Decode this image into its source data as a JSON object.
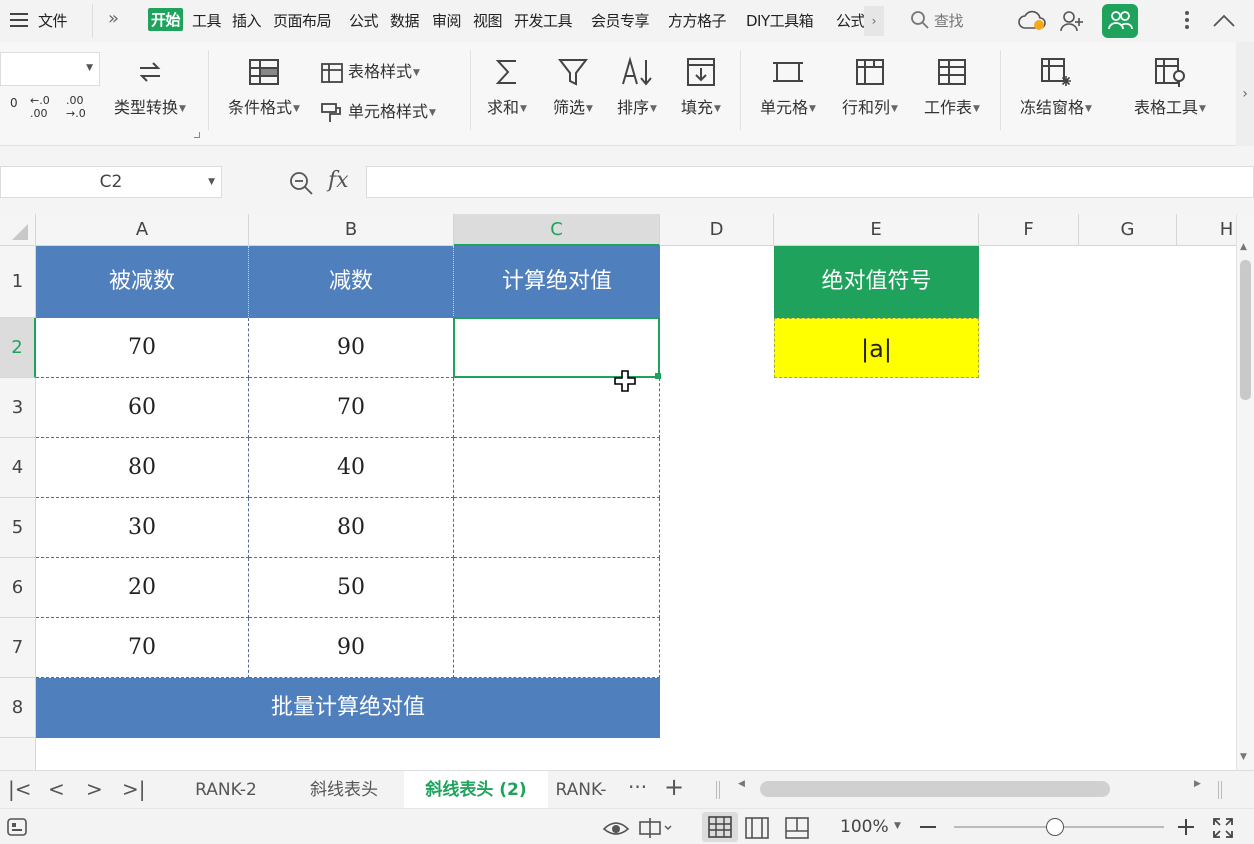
{
  "menubar": {
    "file_label": "文件",
    "more_label": "»",
    "tabs": [
      "开始",
      "工具",
      "插入",
      "页面布局",
      "公式",
      "数据",
      "审阅",
      "视图",
      "开发工具",
      "会员专享",
      "方方格子",
      "DIY工具箱",
      "公式"
    ],
    "search_label": "查找"
  },
  "ribbon": {
    "number_format_buttons": [
      "0",
      "←.0 .00",
      ".00 →.0"
    ],
    "type_convert_label": "类型转换",
    "conditional_format_label": "条件格式",
    "table_style_label": "表格样式",
    "cell_style_label": "单元格样式",
    "sum_label": "求和",
    "filter_label": "筛选",
    "sort_label": "排序",
    "fill_label": "填充",
    "cell_label": "单元格",
    "row_col_label": "行和列",
    "worksheet_label": "工作表",
    "freeze_label": "冻结窗格",
    "table_tools_label": "表格工具"
  },
  "formula_bar": {
    "name_box": "C2",
    "fx_label": "fx",
    "formula": ""
  },
  "grid": {
    "columns": [
      "A",
      "B",
      "C",
      "D",
      "E",
      "F",
      "G",
      "H"
    ],
    "rows": [
      "1",
      "2",
      "3",
      "4",
      "5",
      "6",
      "7",
      "8"
    ],
    "selected_cell": "C2",
    "table_headers": [
      "被减数",
      "减数",
      "计算绝对值"
    ],
    "table_rows": [
      [
        "70",
        "90",
        ""
      ],
      [
        "60",
        "70",
        ""
      ],
      [
        "80",
        "40",
        ""
      ],
      [
        "30",
        "80",
        ""
      ],
      [
        "20",
        "50",
        ""
      ],
      [
        "70",
        "90",
        ""
      ]
    ],
    "footer_label": "批量计算绝对值",
    "side_header": "绝对值符号",
    "side_value": "|a|",
    "colors": {
      "table_header_bg": "#4f7fbd",
      "side_header_bg": "#1fa35c",
      "side_value_bg": "#ffff00",
      "selection": "#1fa35c"
    }
  },
  "sheet_tabs": {
    "tabs": [
      "RANK-2",
      "斜线表头",
      "斜线表头 (2)",
      "RANK-"
    ],
    "active_index": 2,
    "more_label": "···",
    "add_label": "+"
  },
  "status_bar": {
    "zoom_label": "100%",
    "zoom_level_percent": 100
  }
}
